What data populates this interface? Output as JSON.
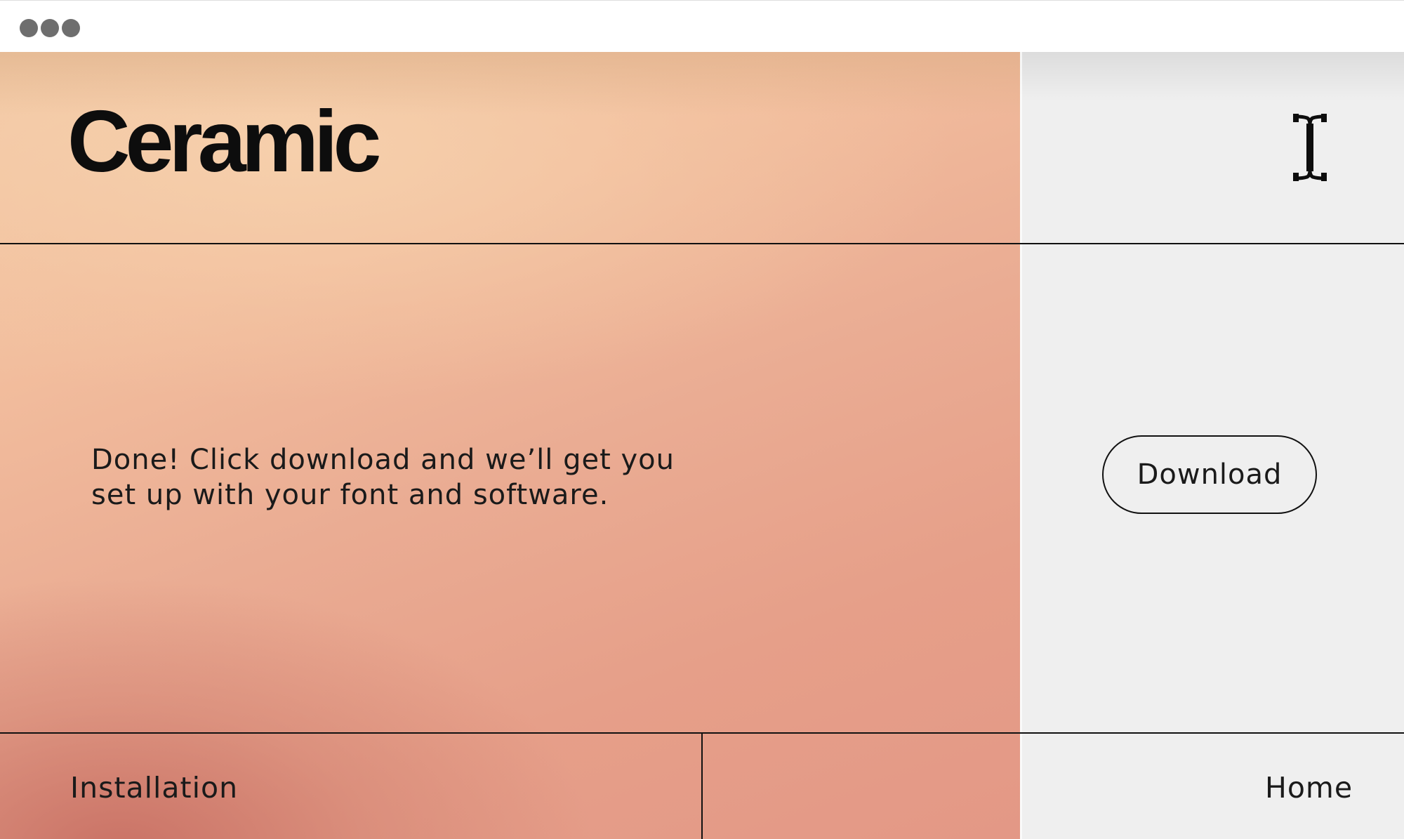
{
  "window": {
    "controls": [
      "dot",
      "dot",
      "dot"
    ]
  },
  "header": {
    "logo": "Ceramic",
    "cursor_icon": "text-cursor-icon"
  },
  "main": {
    "message_line1": "Done! Click download and we’ll get you",
    "message_line2": "set up with your font and software.",
    "download_label": "Download"
  },
  "footer": {
    "installation_label": "Installation",
    "home_label": "Home"
  },
  "colors": {
    "gradient_top": "#f3cda9",
    "gradient_bottom_left": "#c87064",
    "gradient_right": "#e39886",
    "side_panel": "#efefef",
    "rule": "#111111",
    "text": "#1a1a1a",
    "window_dot": "#6e6e6e"
  }
}
